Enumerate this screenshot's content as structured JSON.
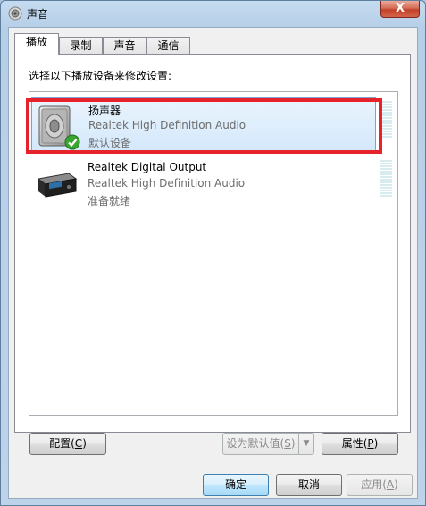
{
  "window": {
    "title": "声音",
    "close_glyph": "X",
    "accent_close": "#c2412a"
  },
  "tabs": [
    {
      "label": "播放",
      "active": true
    },
    {
      "label": "录制",
      "active": false
    },
    {
      "label": "声音",
      "active": false
    },
    {
      "label": "通信",
      "active": false
    }
  ],
  "panel": {
    "instruction": "选择以下播放设备来修改设置:"
  },
  "devices": [
    {
      "name": "扬声器",
      "driver": "Realtek High Definition Audio",
      "status": "默认设备",
      "icon": "speaker-icon",
      "selected": true,
      "is_default": true
    },
    {
      "name": "Realtek Digital Output",
      "driver": "Realtek High Definition Audio",
      "status": "准备就绪",
      "icon": "digital-output-device-icon",
      "selected": false,
      "is_default": false
    }
  ],
  "buttons": {
    "configure_prefix": "配置(",
    "configure_key": "C",
    "configure_suffix": ")",
    "set_default_prefix": "设为默认值(",
    "set_default_key": "S",
    "set_default_suffix": ")",
    "split_arrow": "▼",
    "properties_prefix": "属性(",
    "properties_key": "P",
    "properties_suffix": ")",
    "ok": "确定",
    "cancel": "取消",
    "apply_prefix": "应用(",
    "apply_key": "A",
    "apply_suffix": ")"
  }
}
